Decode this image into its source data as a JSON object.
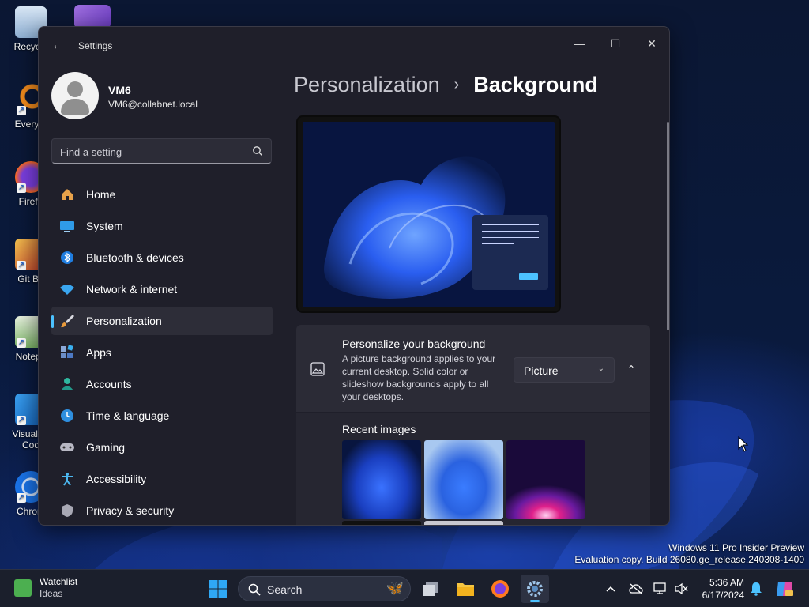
{
  "desktop": {
    "icons": [
      {
        "label": "Recycle",
        "icon": "recycle-bin-icon"
      },
      {
        "label": "Everyth",
        "icon": "everything-icon"
      },
      {
        "label": "Firefo",
        "icon": "firefox-icon"
      },
      {
        "label": "Git Ba",
        "icon": "git-bash-icon"
      },
      {
        "label": "Notepa",
        "icon": "notepad-icon"
      },
      {
        "label": "Visual St",
        "label2": "Cod",
        "icon": "vscode-icon"
      },
      {
        "label": "Chrom",
        "icon": "chrome-icon"
      }
    ],
    "watermark_line1": "Windows 11 Pro Insider Preview",
    "watermark_line2": "Evaluation copy. Build 26080.ge_release.240308-1400"
  },
  "window": {
    "title": "Settings",
    "back_glyph": "←",
    "minimize_glyph": "—",
    "maximize_glyph": "☐",
    "close_glyph": "✕"
  },
  "profile": {
    "name": "VM6",
    "email": "VM6@collabnet.local"
  },
  "search": {
    "placeholder": "Find a setting"
  },
  "nav": {
    "items": [
      {
        "label": "Home",
        "icon": "home-icon"
      },
      {
        "label": "System",
        "icon": "system-icon"
      },
      {
        "label": "Bluetooth & devices",
        "icon": "bluetooth-icon"
      },
      {
        "label": "Network & internet",
        "icon": "network-icon"
      },
      {
        "label": "Personalization",
        "icon": "brush-icon",
        "active": true
      },
      {
        "label": "Apps",
        "icon": "apps-icon"
      },
      {
        "label": "Accounts",
        "icon": "accounts-icon"
      },
      {
        "label": "Time & language",
        "icon": "time-language-icon"
      },
      {
        "label": "Gaming",
        "icon": "gaming-icon"
      },
      {
        "label": "Accessibility",
        "icon": "accessibility-icon"
      },
      {
        "label": "Privacy & security",
        "icon": "shield-icon"
      }
    ]
  },
  "content": {
    "breadcrumb_parent": "Personalization",
    "breadcrumb_sep": "›",
    "breadcrumb_current": "Background",
    "background_card": {
      "title": "Personalize your background",
      "description": "A picture background applies to your current desktop. Solid color or slideshow backgrounds apply to all your desktops.",
      "dropdown_value": "Picture",
      "dropdown_chevron": "⌄",
      "collapse_glyph": "⌃"
    },
    "recent_images_title": "Recent images"
  },
  "taskbar": {
    "widget_title": "Watchlist",
    "widget_subtitle": "Ideas",
    "search_label": "Search",
    "time": "5:36 AM",
    "date": "6/17/2024"
  },
  "colors": {
    "accent": "#4cc2ff",
    "window_bg": "#1f1f2a",
    "card_bg": "#2b2b36"
  }
}
